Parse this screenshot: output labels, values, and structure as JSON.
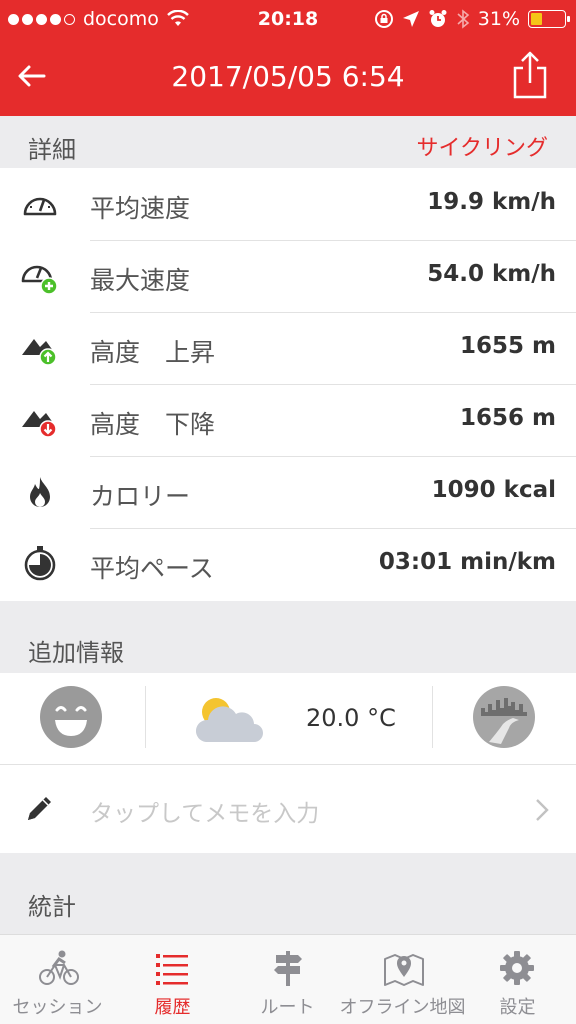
{
  "status_bar": {
    "carrier": "docomo",
    "time": "20:18",
    "battery": "31%"
  },
  "header": {
    "title": "2017/05/05 6:54"
  },
  "details": {
    "section_label": "詳細",
    "activity_type": "サイクリング",
    "rows": [
      {
        "icon": "speedometer-icon",
        "label": "平均速度",
        "value": "19.9 km/h"
      },
      {
        "icon": "speedometer-plus-icon",
        "label": "最大速度",
        "value": "54.0 km/h"
      },
      {
        "icon": "mountain-up-icon",
        "label": "高度　上昇",
        "value": "1655 m"
      },
      {
        "icon": "mountain-down-icon",
        "label": "高度　下降",
        "value": "1656 m"
      },
      {
        "icon": "flame-icon",
        "label": "カロリー",
        "value": "1090 kcal"
      },
      {
        "icon": "stopwatch-icon",
        "label": "平均ペース",
        "value": "03:01 min/km"
      }
    ]
  },
  "extra": {
    "section_label": "追加情報",
    "mood_icon": "smiley-face-icon",
    "weather_icon": "partly-cloudy-icon",
    "temperature": "20.0 °C",
    "surface_icon": "city-road-icon"
  },
  "memo": {
    "placeholder": "タップしてメモを入力"
  },
  "stats": {
    "section_label": "統計"
  },
  "tabbar": {
    "tabs": [
      {
        "label": "セッション",
        "icon": "cyclist-icon",
        "active": false
      },
      {
        "label": "履歴",
        "icon": "list-icon",
        "active": true
      },
      {
        "label": "ルート",
        "icon": "signpost-icon",
        "active": false
      },
      {
        "label": "オフライン地図",
        "icon": "map-pin-icon",
        "active": false
      },
      {
        "label": "設定",
        "icon": "gear-icon",
        "active": false
      }
    ]
  },
  "colors": {
    "accent": "#e52c2c",
    "section_bg": "#ececee",
    "green_badge": "#4cc02a",
    "red_badge": "#e52c2c"
  }
}
